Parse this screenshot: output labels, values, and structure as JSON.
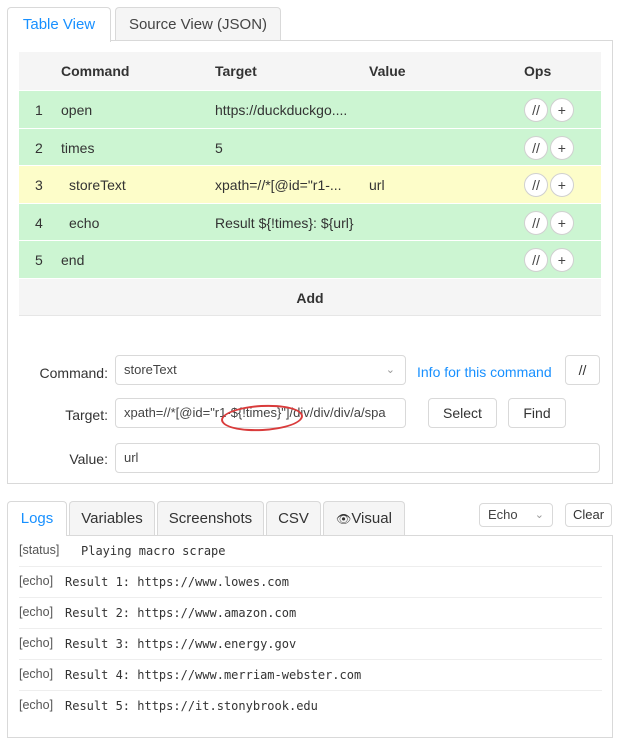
{
  "tabs": {
    "table_view": "Table View",
    "source_view": "Source View (JSON)"
  },
  "table": {
    "headers": {
      "command": "Command",
      "target": "Target",
      "value": "Value",
      "ops": "Ops"
    },
    "rows": [
      {
        "index": "1",
        "command": "open",
        "target": "https://duckduckgo....",
        "value": ""
      },
      {
        "index": "2",
        "command": "times",
        "target": "5",
        "value": ""
      },
      {
        "index": "3",
        "command": "storeText",
        "target": "xpath=//*[@id=\"r1-...",
        "value": "url"
      },
      {
        "index": "4",
        "command": "echo",
        "target": "Result ${!times}: ${url}",
        "value": ""
      },
      {
        "index": "5",
        "command": "end",
        "target": "",
        "value": ""
      }
    ],
    "op_comment": "//",
    "op_add": "+",
    "add_label": "Add"
  },
  "editor": {
    "command_label": "Command",
    "command_value": "storeText",
    "info_link": "Info for this command",
    "comment_button": "//",
    "target_label": "Target",
    "target_value": "xpath=//*[@id=\"r1-${!times}\"]/div/div/div/a/spa",
    "select_button": "Select",
    "find_button": "Find",
    "value_label": "Value",
    "value_value": "url"
  },
  "logs": {
    "tabs": [
      "Logs",
      "Variables",
      "Screenshots",
      "CSV",
      "Visual"
    ],
    "level_select": "Echo",
    "clear_button": "Clear",
    "lines": [
      {
        "tag": "[status]",
        "text": "Playing macro scrape"
      },
      {
        "tag": "[echo]",
        "text": "Result 1: https://www.lowes.com"
      },
      {
        "tag": "[echo]",
        "text": "Result 2: https://www.amazon.com"
      },
      {
        "tag": "[echo]",
        "text": "Result 3: https://www.energy.gov"
      },
      {
        "tag": "[echo]",
        "text": "Result 4: https://www.merriam-webster.com"
      },
      {
        "tag": "[echo]",
        "text": "Result 5: https://it.stonybrook.edu"
      }
    ]
  },
  "colors": {
    "accent": "#1890ff",
    "row_green": "#ccf5d2",
    "row_yellow": "#fdfdc9",
    "annotation_red": "#d93b3b"
  },
  "icons": {
    "dropdown": "chevron-down-icon",
    "visual_tab": "eye-icon"
  }
}
